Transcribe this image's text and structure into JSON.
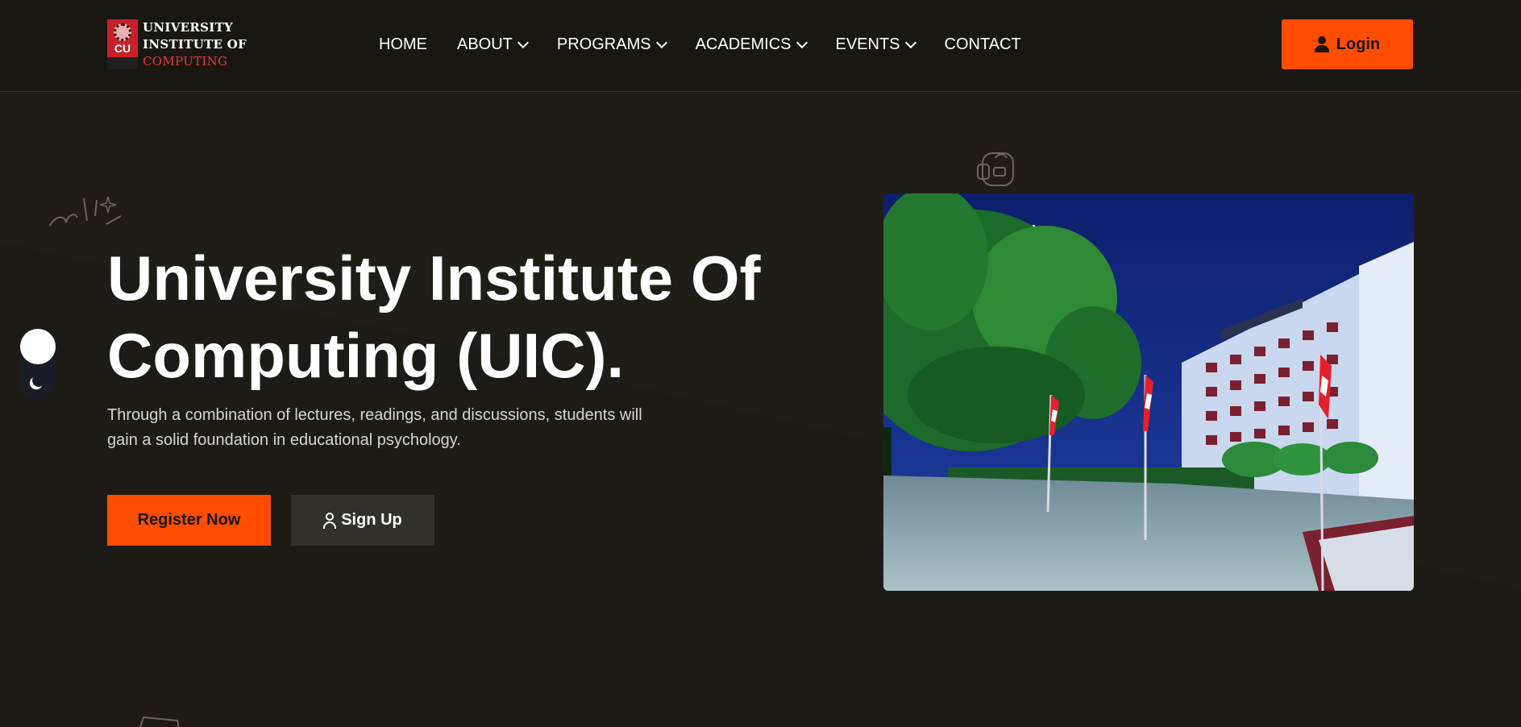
{
  "header": {
    "logo": {
      "badge_text": "CU",
      "line1": "UNIVERSITY",
      "line2": "INSTITUTE OF",
      "line3": "COMPUTING"
    },
    "nav": [
      {
        "label": "HOME",
        "dropdown": false
      },
      {
        "label": "ABOUT",
        "dropdown": true
      },
      {
        "label": "PROGRAMS",
        "dropdown": true
      },
      {
        "label": "ACADEMICS",
        "dropdown": true
      },
      {
        "label": "EVENTS",
        "dropdown": true
      },
      {
        "label": "CONTACT",
        "dropdown": false
      }
    ],
    "login_label": "Login"
  },
  "hero": {
    "title_line1": "University Institute Of",
    "title_line2": "Computing (UIC).",
    "subtitle_line1": "Through a combination of lectures, readings, and discussions, students will",
    "subtitle_line2": "gain a solid foundation in educational psychology.",
    "register_label": "Register Now",
    "signup_label": "Sign Up"
  },
  "theme_toggle": {
    "mode": "dark",
    "icon": "moon-icon"
  },
  "colors": {
    "background": "#1a1712",
    "accent": "#ff4d00",
    "secondary_button": "#34312c",
    "text": "#ffffff"
  },
  "icons": [
    "chevron-down-icon",
    "user-icon",
    "moon-icon",
    "doodle-sparkle-icon",
    "backpack-icon"
  ]
}
